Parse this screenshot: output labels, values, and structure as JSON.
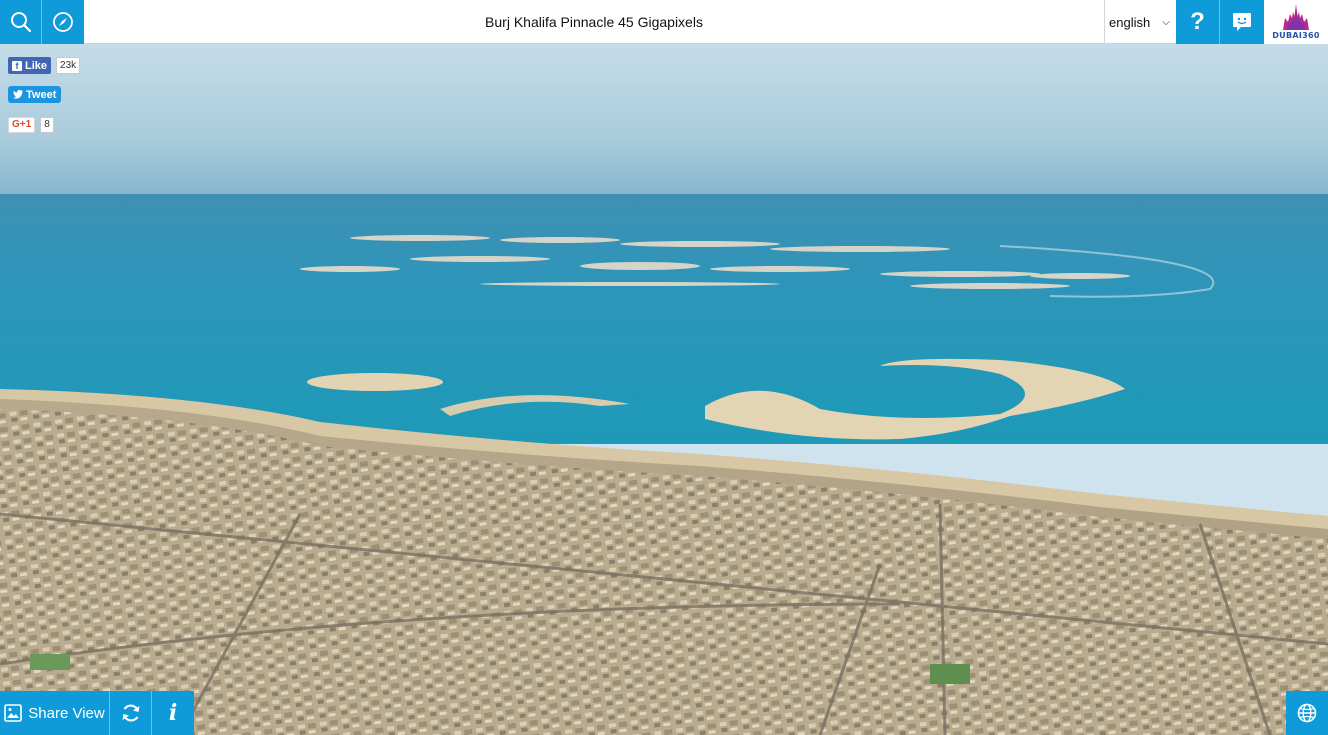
{
  "header": {
    "title": "Burj Khalifa Pinnacle 45 Gigapixels",
    "language": "english",
    "help_glyph": "?",
    "logo_text": "DUBAI360"
  },
  "social": {
    "facebook_label": "Like",
    "facebook_count": "23k",
    "tweet_label": "Tweet",
    "gplus_label": "G+1",
    "gplus_count": "8"
  },
  "bottom": {
    "share_label": "Share View",
    "info_glyph": "i"
  },
  "icons": [
    "search-icon",
    "compass-icon",
    "help-icon",
    "feedback-icon",
    "share-image-icon",
    "refresh-icon",
    "info-icon",
    "globe-icon"
  ],
  "colors": {
    "accent": "#0f9ad9",
    "facebook": "#4267b2",
    "twitter": "#1b95e0",
    "gplus": "#dd4b39"
  }
}
